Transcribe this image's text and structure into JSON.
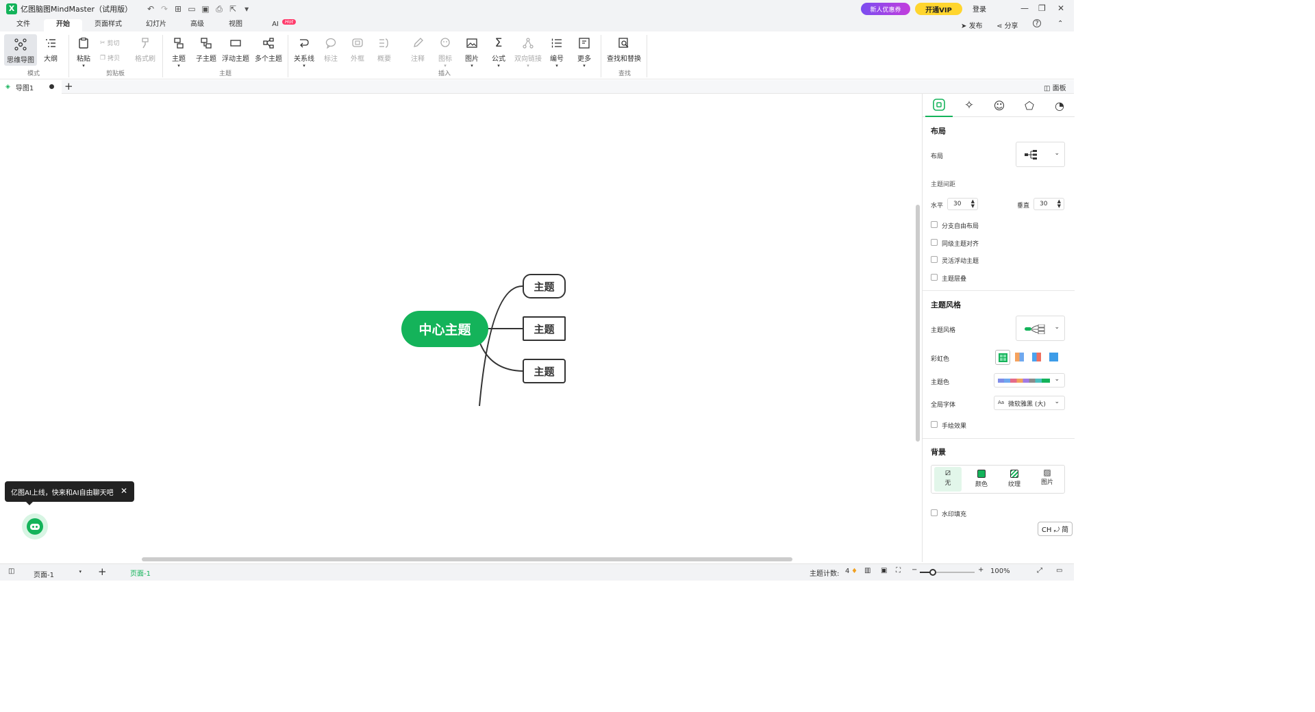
{
  "titlebar": {
    "logo": "X",
    "app_title": "亿图脑图MindMaster（试用版）",
    "promo": "新人优惠券",
    "vip": "开通VIP",
    "login": "登录"
  },
  "menu": {
    "tabs": [
      "文件",
      "开始",
      "页面样式",
      "幻灯片",
      "高级",
      "视图",
      "AI"
    ],
    "ai_badge": "Hot",
    "publish": "发布",
    "share": "分享",
    "help": "?"
  },
  "ribbon": {
    "mode": {
      "mindmap": "思维导图",
      "outline": "大纲",
      "group": "模式"
    },
    "clipboard": {
      "paste": "粘贴",
      "cut": "剪切",
      "copy": "拷贝",
      "format_painter": "格式刷",
      "group": "剪贴板"
    },
    "topic": {
      "topic": "主题",
      "subtopic": "子主题",
      "floating": "浮动主题",
      "multi": "多个主题",
      "group": "主题"
    },
    "insert": {
      "relation": "关系线",
      "callout": "标注",
      "boundary": "外框",
      "summary": "概要",
      "note": "注释",
      "icon": "图标",
      "image": "图片",
      "formula": "公式",
      "bilink": "双向链接",
      "numbering": "编号",
      "more": "更多",
      "group": "插入"
    },
    "find": {
      "find_replace": "查找和替换",
      "group": "查找"
    }
  },
  "doc_tabs": {
    "tab1": "导图1",
    "add": "+",
    "panel_toggle": "面板"
  },
  "mindmap": {
    "central": "中心主题",
    "branches": [
      "主题",
      "主题",
      "主题"
    ],
    "colors": {
      "central": "#14b35a",
      "line": "#333333"
    }
  },
  "panel": {
    "layout_header": "布局",
    "layout_label": "布局",
    "spacing_label": "主题间距",
    "horizontal_label": "水平",
    "horizontal_value": "30",
    "vertical_label": "垂直",
    "vertical_value": "30",
    "checks1": [
      "分支自由布局",
      "同级主题对齐",
      "灵活浮动主题",
      "主题层叠"
    ],
    "style_header": "主题风格",
    "style_label": "主题风格",
    "rainbow_label": "彩虹色",
    "theme_color_label": "主题色",
    "font_label": "全局字体",
    "font_value": "微软雅黑 (大)",
    "handdrawn": "手绘效果",
    "bg_header": "背景",
    "bg_options": [
      "无",
      "颜色",
      "纹理",
      "图片"
    ],
    "watermark": "水印填充"
  },
  "status": {
    "page_select": "页面-1",
    "page_tab": "页面-1",
    "topic_count_label": "主题计数:",
    "topic_count": "4",
    "zoom": "100%"
  },
  "tooltip": {
    "text": "亿图AI上线，快来和AI自由聊天吧"
  },
  "ime": {
    "text": "CH ⤾ 简"
  }
}
